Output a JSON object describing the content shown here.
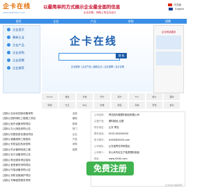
{
  "header": {
    "logo_text": "企卡在线",
    "logo_url": "www.qikazaixian.com",
    "slogan": "以最简单的方式展示企业最全面的信息",
    "subslogan": "企业自助，网络上的企业名片",
    "lang_cn": "中文版",
    "lang_en": "English"
  },
  "nav": [
    "首页",
    "企业",
    "产品",
    "求购",
    "招聘"
  ],
  "sidebar": [
    {
      "label": "企业首页"
    },
    {
      "label": "最新企业"
    },
    {
      "label": "企业产品"
    },
    {
      "label": "企业求购"
    },
    {
      "label": "企业招聘"
    },
    {
      "label": "企业推荐"
    }
  ],
  "banner": {
    "title": "企卡在线",
    "search_placeholder": "",
    "search_button": "搜 索",
    "sublinks": "企业搜索 | 企业产品 | 最新企业 | 企业招聘 | 名片互换"
  },
  "ad": {
    "title": "企业网站建设"
  },
  "logos": [
    "bauer",
    "福龙",
    "长城",
    "华为",
    "海尔",
    "TCL",
    "格力",
    "美的",
    "联想",
    "方正",
    "中兴",
    "创维",
    "康佳",
    "海信",
    "奇瑞",
    "吉利",
    "长虹"
  ],
  "list_rows": [
    "[招标] 自动化控制设备采购",
    "[招标] 园林绿化工程施工项目",
    "[招标] 医疗设备采购项目",
    "[招标] 办公用品采购公告",
    "[招标] 校园信息化建设项目",
    "[招标] 道路维修工程招标",
    "[招标] 安防监控系统采购",
    "[招标] 供水管网改造工程",
    "[招标] 电力设备采购公告",
    "[招标] 物业服务项目招标",
    "[招标] 食堂食材采购项目",
    "[招标] 环保设备采购公告",
    "[招标] 消防设施维护项目",
    "[招标] 车辆租赁服务采购"
  ],
  "list_tabs": [
    "全部",
    "最新",
    "推荐",
    "热门",
    "企业",
    "产品",
    "求购",
    "招聘"
  ],
  "detail": {
    "rows": [
      {
        "label": "公司名称:",
        "value": "青岛四利德塑料制品有限公司"
      },
      {
        "label": "主营产品:",
        "value": "塑料制品 注塑"
      },
      {
        "label": "所在地区:",
        "value": "山东 青岛"
      },
      {
        "label": "联系电话:",
        "value": "0532-XXXXXXXX"
      },
      {
        "label": "电子邮件:",
        "value": "XXXX@XXXX.com"
      },
      {
        "label": "公司地址:",
        "value": "山东省青岛市即墨区"
      },
      {
        "label": "公司简介:",
        "value": "本公司专业生产各类塑料制品"
      },
      {
        "label": "网址:",
        "value": "www.XXXX.com"
      }
    ]
  },
  "free_button": "免费注册",
  "footer": "企卡在线 版权所有"
}
